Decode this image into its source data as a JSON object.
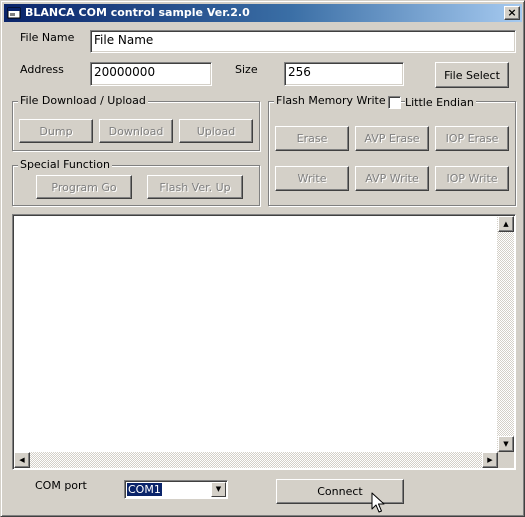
{
  "window": {
    "title": "BLANCA COM control sample  Ver.2.0",
    "close_glyph": "×"
  },
  "form": {
    "file_name_label": "File Name",
    "file_name_value": "File Name",
    "address_label": "Address",
    "address_value": "20000000",
    "size_label": "Size",
    "size_value": "256",
    "file_select_label": "File Select"
  },
  "file_transfer": {
    "group_label": "File Download / Upload",
    "buttons": [
      "Dump",
      "Download",
      "Upload"
    ]
  },
  "special_function": {
    "group_label": "Special Function",
    "buttons": [
      "Program Go",
      "Flash Ver. Up"
    ]
  },
  "flash_memory": {
    "group_label": "Flash Memory Write",
    "little_endian_label": "Little Endian",
    "little_endian_checked": false,
    "erase_buttons": [
      "Erase",
      "AVP Erase",
      "IOP Erase"
    ],
    "write_buttons": [
      "Write",
      "AVP Write",
      "IOP Write"
    ]
  },
  "output": {
    "text": ""
  },
  "footer": {
    "com_port_label": "COM port",
    "com_port_value": "COM1",
    "connect_label": "Connect"
  },
  "icons": {
    "window": "app-window-icon",
    "close": "close-icon",
    "scroll_up": "arrow-up-icon",
    "scroll_down": "arrow-down-icon",
    "scroll_left": "arrow-left-icon",
    "scroll_right": "arrow-right-icon",
    "combo": "chevron-down-icon",
    "cursor": "mouse-pointer-icon"
  }
}
